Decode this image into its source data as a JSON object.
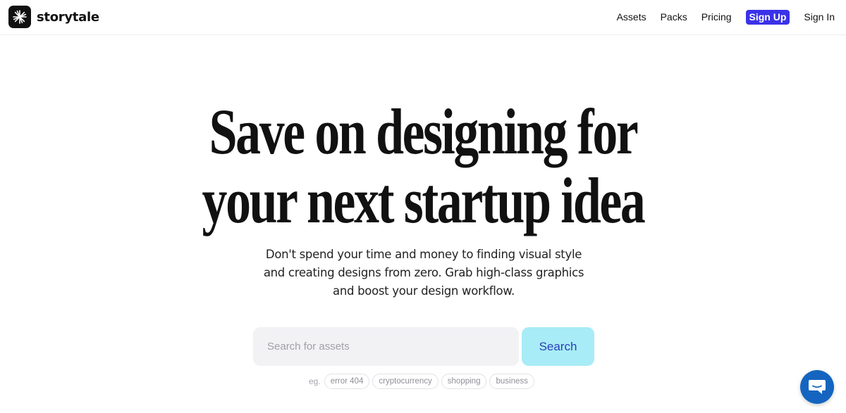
{
  "brand": {
    "name": "storytale"
  },
  "nav": {
    "items": [
      {
        "label": "Assets"
      },
      {
        "label": "Packs"
      },
      {
        "label": "Pricing"
      }
    ],
    "signup_label": "Sign Up",
    "signin_label": "Sign In"
  },
  "hero": {
    "title_line1": "Save on designing for",
    "title_line2": "your next startup idea",
    "subtitle": "Don't spend your time and money to finding visual style and creating designs from zero. Grab high-class graphics and boost your design workflow."
  },
  "search": {
    "placeholder": "Search for assets",
    "button_label": "Search",
    "examples_prefix": "eg.",
    "examples": [
      "error 404",
      "cryptocurrency",
      "shopping",
      "business"
    ]
  },
  "chat": {
    "icon": "chat-bubble-icon"
  },
  "colors": {
    "accent": "#3b32e8",
    "search_button_bg": "#a8ecf7",
    "search_button_text": "#2a3fb8",
    "chat_bg": "#1565c0"
  }
}
